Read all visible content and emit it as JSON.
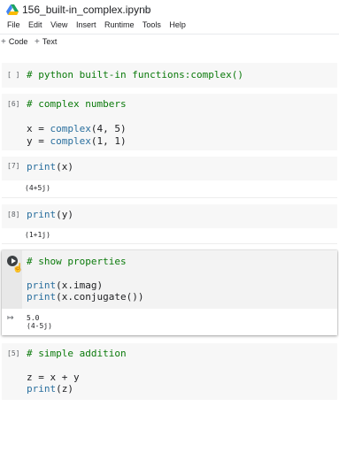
{
  "header": {
    "title": "156_built-in_complex.ipynb",
    "drive_icon": "google-drive-icon",
    "star_icon": "star-outline-icon"
  },
  "menu": [
    "File",
    "Edit",
    "View",
    "Insert",
    "Runtime",
    "Tools",
    "Help"
  ],
  "toolbar": {
    "code_label": "Code",
    "text_label": "Text"
  },
  "cells": [
    {
      "prompt": "[ ]",
      "lines": [
        "# python built-in functions:complex()"
      ],
      "output": ""
    },
    {
      "prompt": "[6]",
      "lines": [
        "# complex numbers",
        "",
        "x = complex(4, 5)",
        "y = complex(1, 1)"
      ],
      "output": ""
    },
    {
      "prompt": "[7]",
      "lines": [
        "print(x)"
      ],
      "output": "(4+5j)"
    },
    {
      "prompt": "[8]",
      "lines": [
        "print(y)"
      ],
      "output": "(1+1j)"
    },
    {
      "prompt": "",
      "lines": [
        "# show properties",
        "",
        "print(x.imag)",
        "print(x.conjugate())"
      ],
      "output": [
        "5.0",
        "(4-5j)"
      ]
    },
    {
      "prompt": "[5]",
      "lines": [
        "# simple addition",
        "",
        "z = x + y",
        "print(z)"
      ],
      "output": ""
    }
  ],
  "colors": {
    "comment": "#0b7a0b",
    "builtin": "#2a6f9e",
    "cell_bg": "#f7f7f7"
  }
}
